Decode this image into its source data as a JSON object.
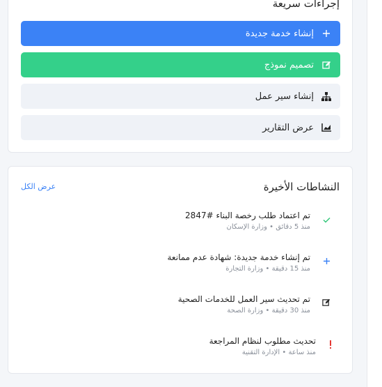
{
  "quick_actions": {
    "title": "إجراءات سريعة",
    "buttons": [
      {
        "label": "إنشاء خدمة جديدة",
        "icon": "plus-icon"
      },
      {
        "label": "تصميم نموذج",
        "icon": "edit-icon"
      },
      {
        "label": "إنشاء سير عمل",
        "icon": "sitemap-icon"
      },
      {
        "label": "عرض التقارير",
        "icon": "chart-area-icon"
      }
    ]
  },
  "recent_activities": {
    "title": "النشاطات الأخيرة",
    "view_all": "عرض الكل",
    "items": [
      {
        "title": "تم اعتماد طلب رخصة البناء #2847",
        "time": "منذ 5 دقائق",
        "org": "وزارة الإسكان",
        "icon": "check-icon",
        "color": "#34c77b"
      },
      {
        "title": "تم إنشاء خدمة جديدة: شهادة عدم ممانعة",
        "time": "منذ 15 دقيقة",
        "org": "وزارة التجارة",
        "icon": "plus-icon",
        "color": "#3b82f6"
      },
      {
        "title": "تم تحديث سير العمل للخدمات الصحية",
        "time": "منذ 30 دقيقة",
        "org": "وزارة الصحة",
        "icon": "edit-icon",
        "color": "#222222"
      },
      {
        "title": "تحديث مطلوب لنظام المراجعة",
        "time": "منذ ساعة",
        "org": "الإدارة التقنية",
        "icon": "exclamation-icon",
        "color": "#e53935"
      }
    ]
  },
  "colors": {
    "primary": "#3b82f6",
    "success": "#34d08a",
    "light": "#eff2f7"
  }
}
